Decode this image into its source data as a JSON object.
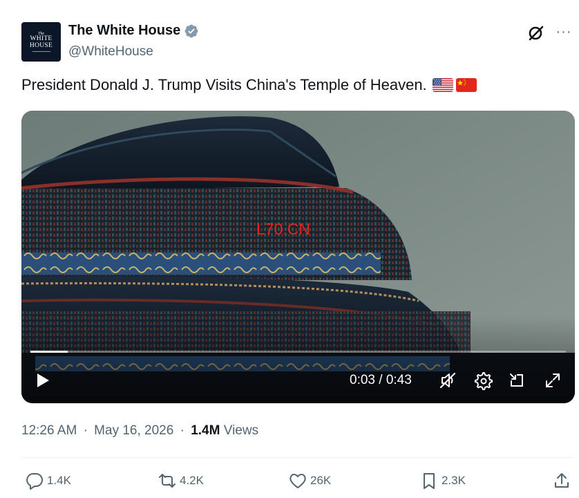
{
  "author": {
    "display_name": "The White House",
    "handle": "@WhiteHouse",
    "verified": true,
    "avatar_text": {
      "small": "The",
      "line1": "WHITE",
      "line2": "HOUSE"
    }
  },
  "tweet": {
    "text": "President Donald J. Trump Visits China's Temple of Heaven.",
    "flags": [
      "us-flag-icon",
      "china-flag-icon"
    ]
  },
  "video": {
    "watermark": "L70.CN",
    "current_time": "0:03",
    "duration": "0:43",
    "time_display": "0:03 / 0:43",
    "progress_fraction": 0.07,
    "muted": true
  },
  "meta": {
    "time": "12:26 AM",
    "date": "May 16, 2026",
    "separator": "·",
    "views_count": "1.4M",
    "views_label": "Views"
  },
  "actions": {
    "replies": "1.4K",
    "reposts": "4.2K",
    "likes": "26K",
    "bookmarks": "2.3K"
  },
  "colors": {
    "text_primary": "#0f1419",
    "text_secondary": "#536471",
    "verified_badge": "#829aab",
    "watermark": "#e0261f"
  }
}
